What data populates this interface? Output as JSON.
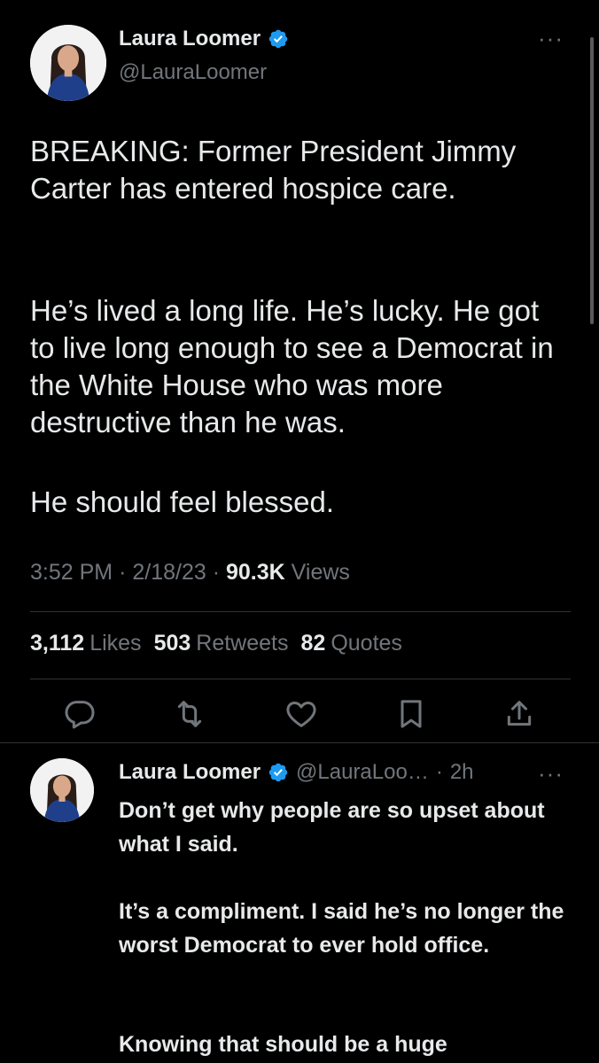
{
  "main_tweet": {
    "author_name": "Laura Loomer",
    "author_handle": "@LauraLoomer",
    "more_icon": "···",
    "paragraphs": [
      "BREAKING: Former President Jimmy Carter has entered hospice care.",
      "He’s lived a long life. He’s lucky. He got to live long enough to see a Democrat in the White House who was more destructive than he was.",
      "He should feel blessed."
    ],
    "time": "3:52 PM",
    "date": "2/18/23",
    "views_count": "90.3K",
    "views_label": "Views",
    "stats": {
      "likes_count": "3,112",
      "likes_label": "Likes",
      "retweets_count": "503",
      "retweets_label": "Retweets",
      "quotes_count": "82",
      "quotes_label": "Quotes"
    },
    "actions": [
      "reply-icon",
      "retweet-icon",
      "like-icon",
      "bookmark-icon",
      "share-icon"
    ]
  },
  "reply_tweet": {
    "author_name": "Laura Loomer",
    "author_handle": "@LauraLoo…",
    "separator": "·",
    "time_ago": "2h",
    "more_icon": "···",
    "paragraphs": [
      "Don’t get why people are so upset about what I said.",
      "It’s a compliment. I said he’s no longer the worst Democrat to ever hold office.",
      "Knowing that should be a huge"
    ]
  },
  "colors": {
    "background": "#000000",
    "text": "#e7e9ea",
    "muted": "#71767b",
    "verified": "#1d9bf0",
    "divider": "#2f3336"
  }
}
